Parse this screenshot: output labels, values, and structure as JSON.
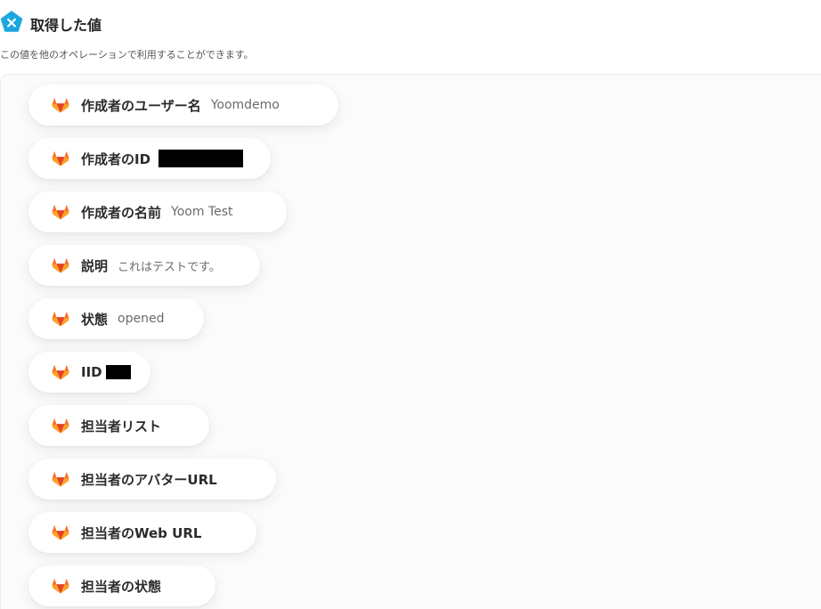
{
  "header": {
    "title": "取得した値",
    "subtitle": "この値を他のオペレーションで利用することができます。",
    "icon": "yoom-x-icon",
    "accent": "#1ba7e0"
  },
  "fields": [
    {
      "label": "作成者のユーザー名",
      "value": "Yoomdemo"
    },
    {
      "label": "作成者のID",
      "value": ""
    },
    {
      "label": "作成者の名前",
      "value": "Yoom Test"
    },
    {
      "label": "説明",
      "value": "これはテストです。"
    },
    {
      "label": "状態",
      "value": "opened"
    },
    {
      "label": "IID",
      "value": ""
    },
    {
      "label": "担当者リスト",
      "value": ""
    },
    {
      "label": "担当者のアバターURL",
      "value": ""
    },
    {
      "label": "担当者のWeb URL",
      "value": ""
    },
    {
      "label": "担当者の状態",
      "value": ""
    }
  ],
  "field_icon": "gitlab-fox-icon",
  "colors": {
    "fox_dark": "#e24329",
    "fox_mid": "#fc6d26",
    "fox_light": "#fca326"
  }
}
